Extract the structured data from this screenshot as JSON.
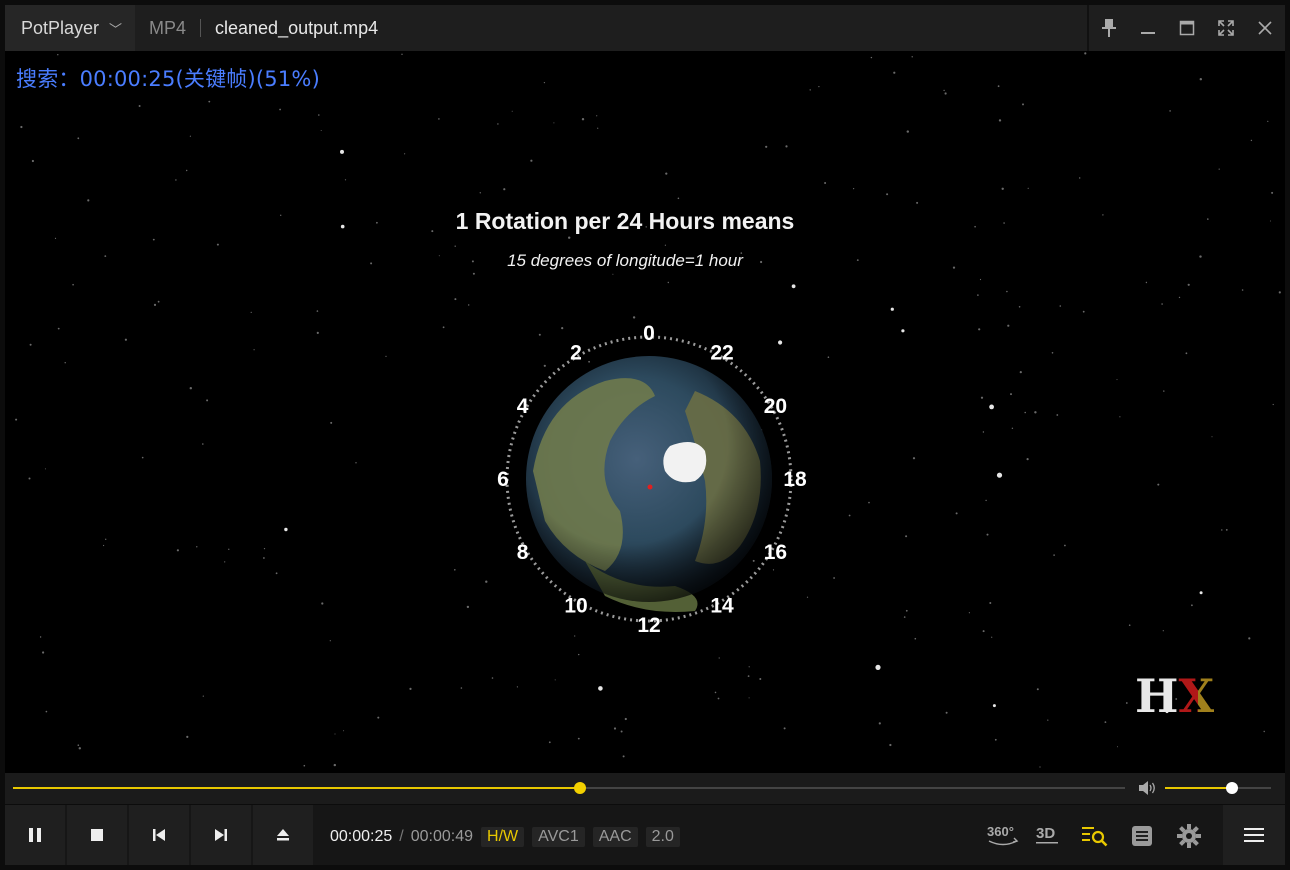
{
  "app": {
    "name": "PotPlayer"
  },
  "titlebar": {
    "format": "MP4",
    "filename": "cleaned_output.mp4",
    "controls": [
      "pin-icon",
      "minimize-icon",
      "maximize-icon",
      "fullscreen-icon",
      "close-icon"
    ]
  },
  "osd": {
    "text": "搜索：00:00:25(关键帧)(51%)"
  },
  "video": {
    "title": "1 Rotation per 24 Hours means",
    "subtitle": "15 degrees of longitude=1 hour",
    "hour_labels": [
      "0",
      "22",
      "20",
      "18",
      "16",
      "14",
      "12",
      "10",
      "8",
      "6",
      "4",
      "2"
    ],
    "watermark_letters": [
      "H",
      "X"
    ]
  },
  "seek": {
    "progress": 0.51
  },
  "volume": {
    "level": 0.63
  },
  "controls": {
    "buttons": [
      "pause-icon",
      "stop-icon",
      "previous-icon",
      "next-icon",
      "eject-icon"
    ],
    "current_time": "00:00:25",
    "separator": "/",
    "total_time": "00:00:49",
    "tags": {
      "hw": "H/W",
      "video_codec": "AVC1",
      "audio_codec": "AAC",
      "channels": "2.0"
    },
    "right_icons": {
      "vr": "360°",
      "stereo": "3D"
    }
  },
  "colors": {
    "accent": "#e8c800",
    "osd": "#4a7dff",
    "hx_h": "#e8e8e8",
    "hx_x_red": "#b01818",
    "hx_x_gold": "#a0801c"
  }
}
